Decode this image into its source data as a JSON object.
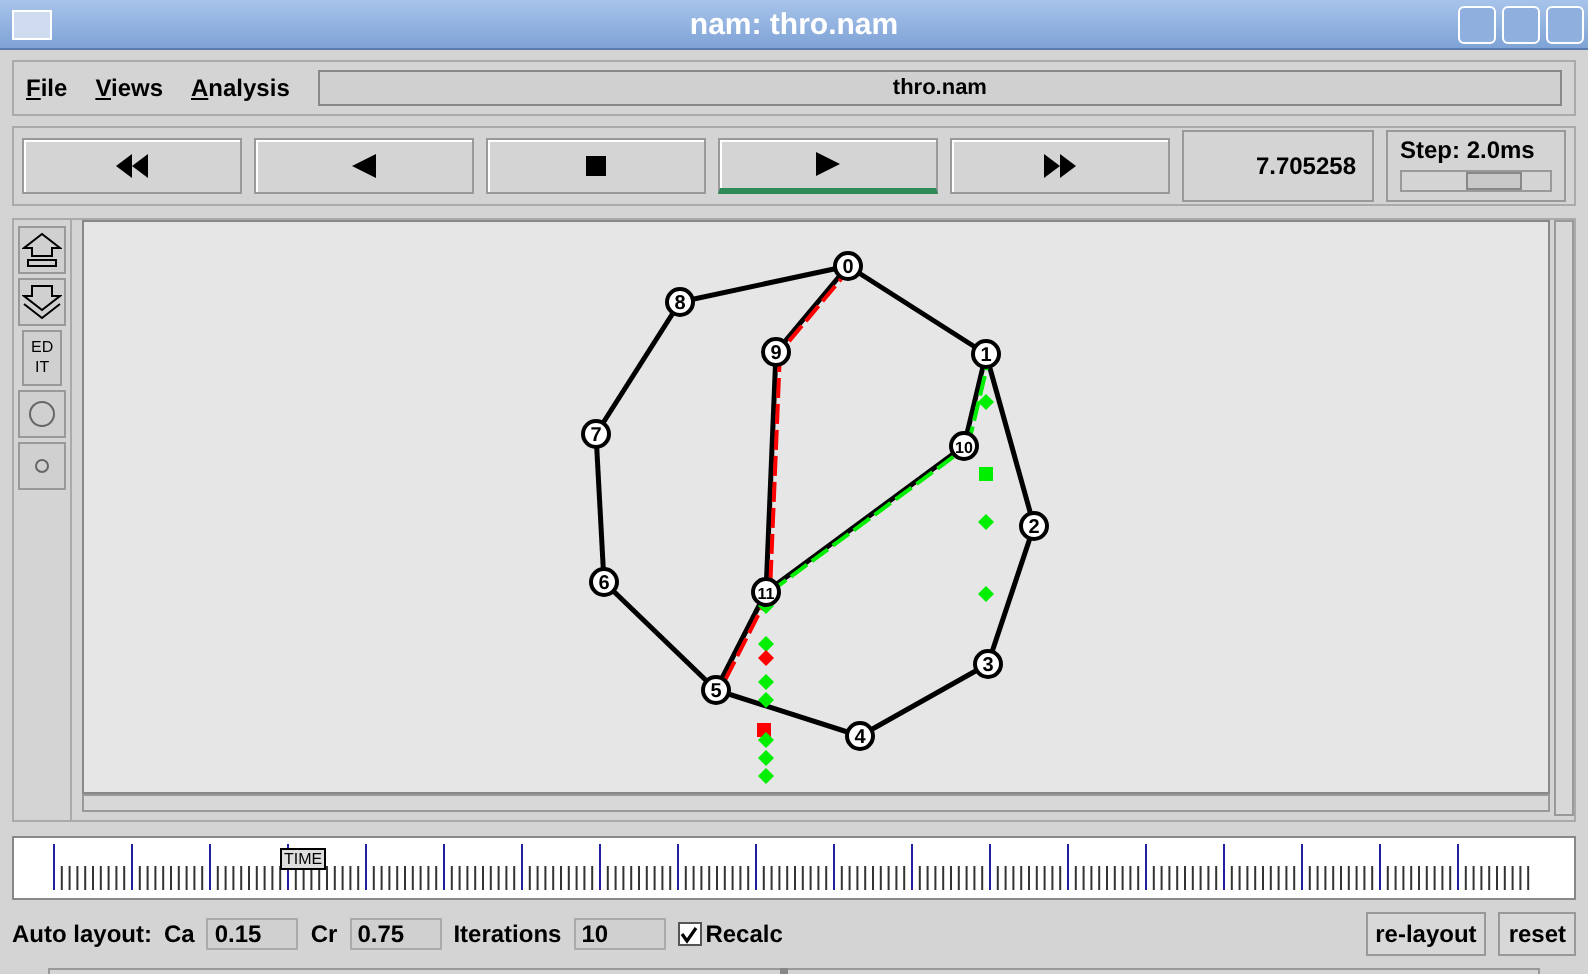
{
  "window": {
    "title": "nam: thro.nam"
  },
  "menu": [
    {
      "label": "File"
    },
    {
      "label": "Views"
    },
    {
      "label": "Analysis"
    }
  ],
  "file_field": "thro.nam",
  "playback": [
    {
      "kind": "rewind",
      "selected": false
    },
    {
      "kind": "back",
      "selected": false
    },
    {
      "kind": "stop",
      "selected": false
    },
    {
      "kind": "play",
      "selected": true
    },
    {
      "kind": "forward",
      "selected": false
    }
  ],
  "time": "7.705258",
  "step": {
    "label": "Step: 2.0ms",
    "level": 0.62
  },
  "tools": [
    {
      "kind": "up"
    },
    {
      "kind": "down"
    },
    {
      "kind": "edit",
      "label": "ED IT"
    },
    {
      "kind": "circle-large"
    },
    {
      "kind": "circle-small"
    }
  ],
  "nodes": [
    "0",
    "1",
    "2",
    "3",
    "4",
    "5",
    "6",
    "7",
    "8",
    "9",
    "10",
    "11"
  ],
  "links": [
    {
      "kind": "duplex"
    },
    {
      "kind": "duplex"
    },
    {
      "kind": "duplex"
    },
    {
      "kind": "duplex"
    },
    {
      "kind": "duplex"
    },
    {
      "kind": "duplex"
    },
    {
      "kind": "duplex"
    },
    {
      "kind": "duplex"
    },
    {
      "kind": "duplex"
    },
    {
      "kind": "duplex",
      "color": "#ff0000"
    },
    {
      "kind": "duplex",
      "color": "#ff0000"
    },
    {
      "kind": "duplex",
      "color": "#ff0000"
    },
    {
      "kind": "duplex",
      "color": "#00ee00"
    },
    {
      "kind": "duplex",
      "color": "#00ee00"
    }
  ],
  "packets": [
    {
      "kind": "diamond",
      "color": "#00ee00"
    },
    {
      "kind": "square",
      "color": "#00ee00"
    },
    {
      "kind": "diamond",
      "color": "#00ee00"
    },
    {
      "kind": "diamond",
      "color": "#00ee00"
    },
    {
      "kind": "diamond",
      "color": "#00ee00"
    },
    {
      "kind": "diamond",
      "color": "#00ee00"
    },
    {
      "kind": "diamond",
      "color": "#ff0000"
    },
    {
      "kind": "diamond",
      "color": "#00ee00"
    },
    {
      "kind": "diamond",
      "color": "#00ee00"
    },
    {
      "kind": "square",
      "color": "#ff0000"
    },
    {
      "kind": "diamond",
      "color": "#00ee00"
    },
    {
      "kind": "diamond",
      "color": "#00ee00"
    },
    {
      "kind": "diamond",
      "color": "#00ee00"
    }
  ],
  "timeline": {
    "marker": "TIME"
  },
  "auto_layout": {
    "label": "Auto layout:",
    "fields": [
      {
        "label": "Ca",
        "value": "0.15"
      },
      {
        "label": "Cr",
        "value": "0.75"
      },
      {
        "label": "Iterations",
        "value": "10"
      }
    ],
    "recalc": {
      "label": "Recalc",
      "checked": true
    }
  },
  "buttons": [
    "re-layout",
    "reset"
  ],
  "bottom_slider": {
    "level": 0.49
  }
}
